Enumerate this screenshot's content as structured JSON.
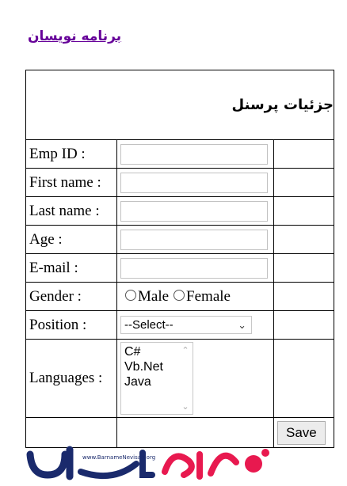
{
  "site_link": "برنامه نویسان",
  "form": {
    "title": "جزئیات پرسنل",
    "fields": [
      {
        "label": "Emp ID :",
        "value": ""
      },
      {
        "label": "First name :",
        "value": ""
      },
      {
        "label": "Last name :",
        "value": ""
      },
      {
        "label": "Age :",
        "value": ""
      },
      {
        "label": "E-mail :",
        "value": ""
      }
    ],
    "gender": {
      "label": "Gender :",
      "options": [
        "Male",
        "Female"
      ]
    },
    "position": {
      "label": "Position :",
      "selected": "--Select--"
    },
    "languages": {
      "label": "Languages :",
      "options": [
        "C#",
        "Vb.Net",
        "Java"
      ]
    },
    "save_label": "Save"
  },
  "logo": {
    "url_text": "www.BarnameNevisan.org",
    "brand_colors": [
      "#1a2a6c",
      "#e8194f"
    ]
  }
}
